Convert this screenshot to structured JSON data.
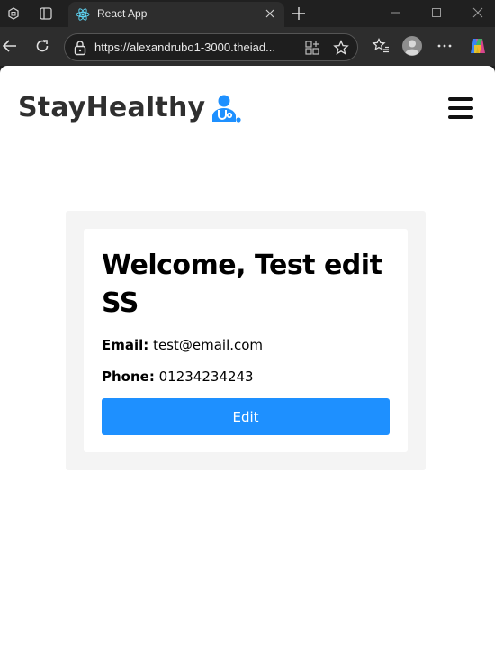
{
  "browser": {
    "tab_title": "React App",
    "url_prefix": "https://",
    "url_host": "alexandrubo1-3000.theiad..."
  },
  "page": {
    "brand": "StayHealthy",
    "welcome": "Welcome, Test edit SS",
    "email_label": "Email:",
    "email_value": "test@email.com",
    "phone_label": "Phone:",
    "phone_value": "01234234243",
    "edit_label": "Edit"
  },
  "colors": {
    "accent": "#1e90ff",
    "brand_text": "#2f2f2f"
  },
  "icons": {
    "brand": "doctor-icon",
    "menu": "hamburger-menu-icon"
  }
}
